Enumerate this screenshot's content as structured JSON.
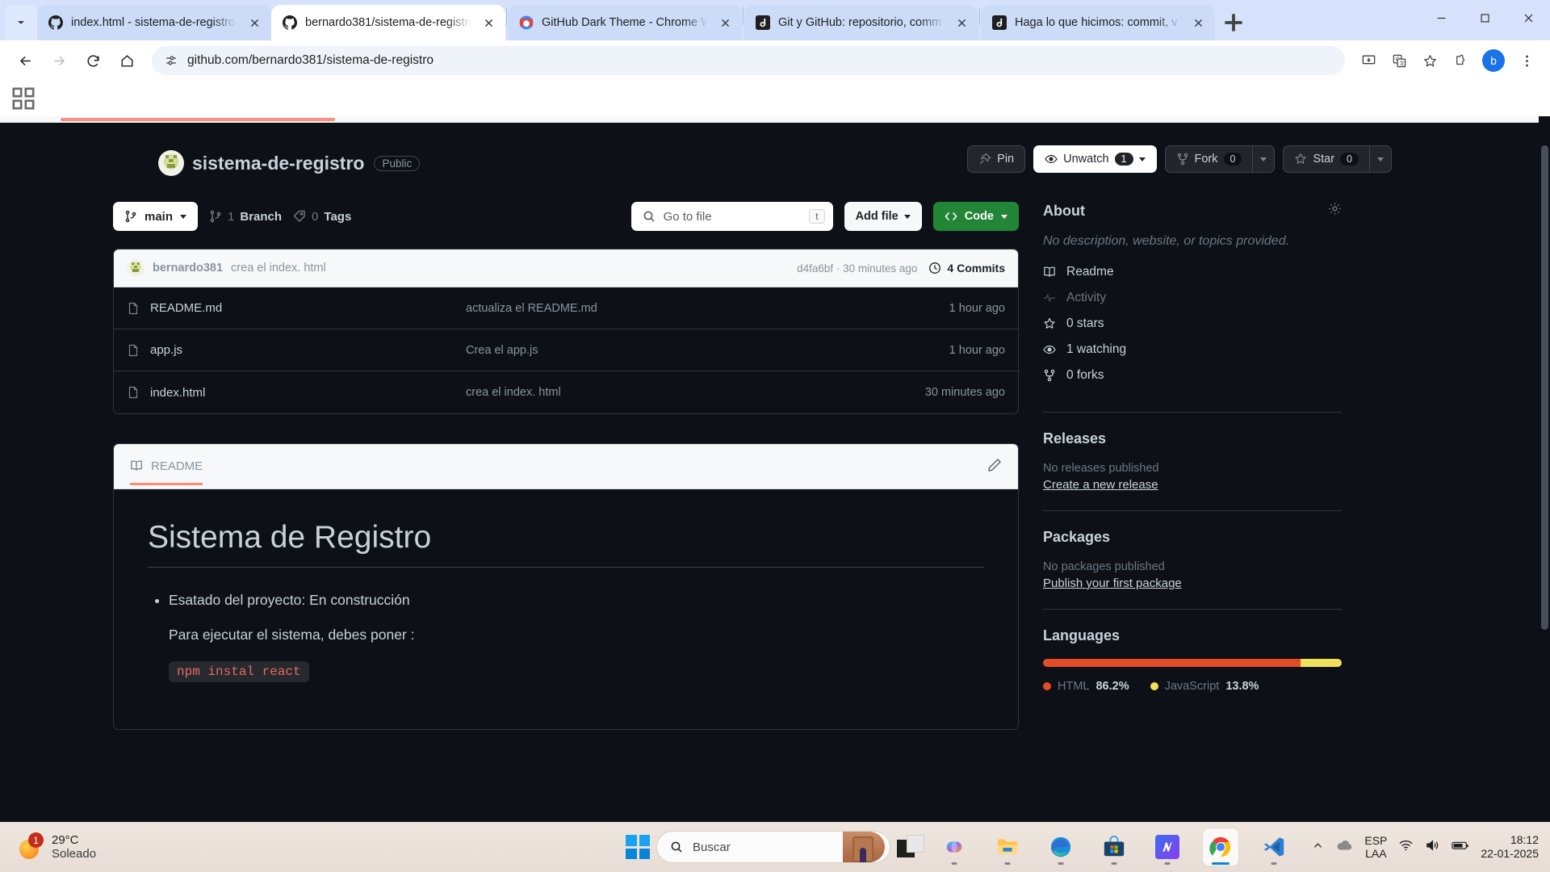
{
  "browser": {
    "tabs": [
      {
        "title": "index.html - sistema-de-registro",
        "icon": "github-icon",
        "active": false
      },
      {
        "title": "bernardo381/sistema-de-registro",
        "icon": "github-icon",
        "active": true
      },
      {
        "title": "GitHub Dark Theme - Chrome W",
        "icon": "chrome-store-icon",
        "active": false
      },
      {
        "title": "Git y GitHub: repositorio, comm",
        "icon": "alura-icon",
        "active": false
      },
      {
        "title": "Haga lo que hicimos: commit, v",
        "icon": "alura-icon",
        "active": false
      }
    ],
    "url": "github.com/bernardo381/sistema-de-registro",
    "profile_initial": "b",
    "icons": {
      "back": "back-arrow-icon",
      "forward": "forward-arrow-icon",
      "reload": "reload-icon",
      "home": "home-icon",
      "site_info": "site-settings-icon",
      "install": "install-app-icon",
      "translate": "translate-icon",
      "bookmark": "bookmark-star-icon",
      "extensions": "extensions-icon",
      "menu": "chrome-menu-icon",
      "new_tab": "new-tab-icon",
      "tab_search": "tab-search-icon"
    }
  },
  "repo": {
    "name": "sistema-de-registro",
    "visibility": "Public",
    "actions": {
      "pin": "Pin",
      "watch": "Unwatch",
      "watch_count": "1",
      "fork": "Fork",
      "fork_count": "0",
      "star": "Star",
      "star_count": "0"
    }
  },
  "nav": {
    "branch": "main",
    "branch_count": "1",
    "branch_label": "Branch",
    "tag_count": "0",
    "tag_label": "Tags",
    "search_placeholder": "Go to file",
    "search_kbd": "t",
    "add_file": "Add file",
    "code": "Code"
  },
  "commit_bar": {
    "author": "bernardo381",
    "message": "crea el index. html",
    "sha": "d4fa6bf",
    "time": "30 minutes ago",
    "commits": "4 Commits"
  },
  "files": [
    {
      "name": "README.md",
      "message": "actualiza el README.md",
      "time": "1 hour ago"
    },
    {
      "name": "app.js",
      "message": "Crea el app.js",
      "time": "1 hour ago"
    },
    {
      "name": "index.html",
      "message": "crea el index. html",
      "time": "30 minutes ago"
    }
  ],
  "readme": {
    "tab_label": "README",
    "title": "Sistema de Registro",
    "bullet": "Esatado del proyecto: En construcción",
    "paragraph": "Para ejecutar el sistema, debes poner :",
    "code": "npm instal react"
  },
  "sidebar": {
    "about_title": "About",
    "about_description": "No description, website, or topics provided.",
    "items": [
      {
        "label": "Readme",
        "icon": "book-icon",
        "dim": false
      },
      {
        "label": "Activity",
        "icon": "pulse-icon",
        "dim": true
      },
      {
        "label": "0 stars",
        "icon": "star-icon",
        "dim": false
      },
      {
        "label": "1 watching",
        "icon": "eye-icon",
        "dim": false
      },
      {
        "label": "0 forks",
        "icon": "fork-icon",
        "dim": false
      }
    ],
    "releases_title": "Releases",
    "releases_empty": "No releases published",
    "releases_link": "Create a new release",
    "packages_title": "Packages",
    "packages_empty": "No packages published",
    "packages_link": "Publish your first package",
    "languages_title": "Languages"
  },
  "chart_data": {
    "type": "bar",
    "title": "Languages",
    "categories": [
      "HTML",
      "JavaScript"
    ],
    "values": [
      86.2,
      13.8
    ],
    "labels": [
      "86.2%",
      "13.8%"
    ],
    "colors": [
      "#e34c26",
      "#f1e05a"
    ],
    "unit": "%",
    "legend": "bottom"
  },
  "taskbar": {
    "weather_temp": "29°C",
    "weather_desc": "Soleado",
    "weather_badge": "1",
    "search_placeholder": "Buscar",
    "apps": [
      {
        "name": "copilot-icon",
        "active": false
      },
      {
        "name": "file-explorer-icon",
        "active": false
      },
      {
        "name": "edge-icon",
        "active": false
      },
      {
        "name": "microsoft-store-icon",
        "active": false
      },
      {
        "name": "mega-icon",
        "active": false
      },
      {
        "name": "chrome-icon",
        "active": true
      },
      {
        "name": "vscode-icon",
        "active": false
      }
    ],
    "lang_line1": "ESP",
    "lang_line2": "LAA",
    "time": "18:12",
    "date": "22-01-2025"
  }
}
